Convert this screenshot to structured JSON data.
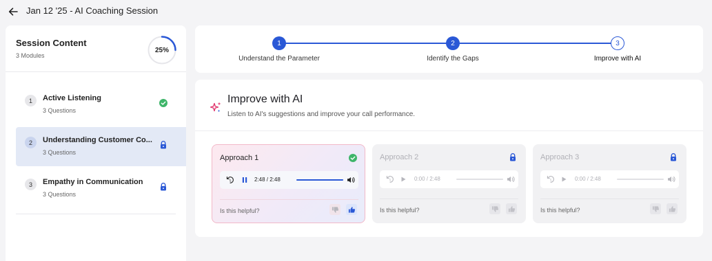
{
  "header": {
    "title": "Jan 12 '25 - AI Coaching Session",
    "back_icon": "arrow-left-icon"
  },
  "sidebar": {
    "title": "Session Content",
    "subtitle": "3 Modules",
    "progress_percent": 25,
    "progress_label": "25%",
    "modules": [
      {
        "number": "1",
        "title": "Active Listening",
        "subtitle": "3 Questions",
        "status": "completed",
        "icon": "check-circle-icon"
      },
      {
        "number": "2",
        "title": "Understanding Customer Co...",
        "subtitle": "3 Questions",
        "status": "locked",
        "icon": "lock-icon"
      },
      {
        "number": "3",
        "title": "Empathy in Communication",
        "subtitle": "3 Questions",
        "status": "locked",
        "icon": "lock-icon"
      }
    ]
  },
  "stepper": {
    "steps": [
      {
        "number": "1",
        "label": "Understand the Parameter"
      },
      {
        "number": "2",
        "label": "Identify the Gaps"
      },
      {
        "number": "3",
        "label": "Improve with AI"
      }
    ]
  },
  "main": {
    "title": "Improve with AI",
    "subtitle": "Listen to AI's suggestions and improve your call performance.",
    "icon": "sparkle-icon",
    "approaches": [
      {
        "title": "Approach 1",
        "time": "2:48 / 2:48",
        "progress": 1.0,
        "playing": true,
        "status": "completed",
        "helpful_label": "Is this helpful?"
      },
      {
        "title": "Approach 2",
        "time": "0:00 / 2:48",
        "progress": 0.0,
        "playing": false,
        "status": "locked",
        "helpful_label": "Is this helpful?"
      },
      {
        "title": "Approach 3",
        "time": "0:00 / 2:48",
        "progress": 0.0,
        "playing": false,
        "status": "locked",
        "helpful_label": "Is this helpful?"
      }
    ]
  },
  "colors": {
    "accent": "#2a58d6",
    "success": "#3fb56a",
    "active_bg": "#e3e9f6"
  }
}
